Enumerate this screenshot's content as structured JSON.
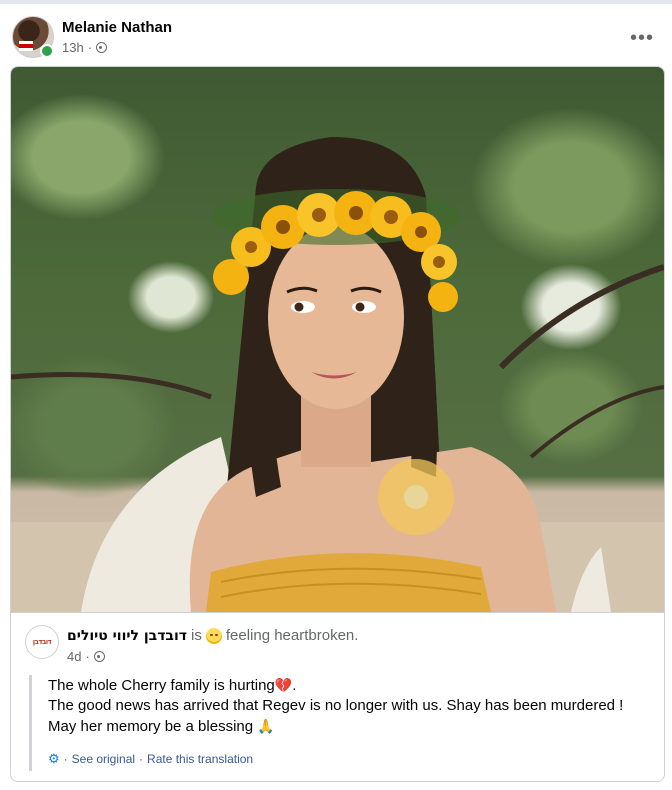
{
  "post": {
    "author": "Melanie Nathan",
    "time": "13h",
    "separator": "·",
    "privacy_icon": "globe-icon",
    "more_icon": "more-options-icon",
    "more_symbol": "•••"
  },
  "shared": {
    "page_name": "דובדבן ליווי טיולים",
    "page_logo_text": "דובדבן",
    "status_is": "is",
    "status_feeling": "feeling heartbroken.",
    "emoji_icon": "sad-face-emoji",
    "time": "4d",
    "separator": "·",
    "text": {
      "line1": "The whole Cherry family is hurting",
      "line1_emoji": "💔",
      "line1_tail": ".",
      "line2": "The good news has arrived that Regev is no longer with us. Shay has been murdered !",
      "line3": "May her memory be a blessing",
      "line3_emoji": "🙏"
    },
    "translation": {
      "see_original": "See original",
      "rate": "Rate this translation",
      "sep": "·"
    }
  },
  "colors": {
    "link": "#385898",
    "online": "#31a24c",
    "accent": "#1877f2"
  }
}
